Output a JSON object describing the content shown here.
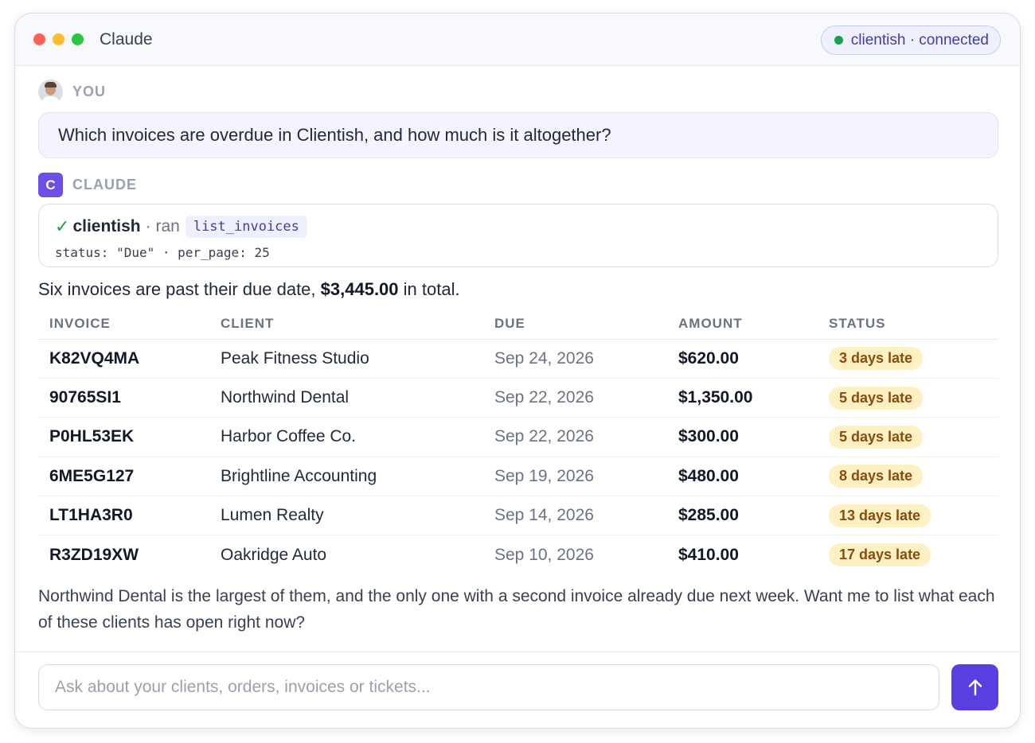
{
  "window": {
    "title": "Claude",
    "connection": "clientish · connected"
  },
  "user_message": {
    "role": "YOU",
    "text": "Which invoices are overdue in Clientish, and how much is it altogether?"
  },
  "assistant": {
    "role": "CLAUDE",
    "avatar_letter": "C",
    "tool_call": {
      "check": "✓",
      "server": "clientish",
      "ran_label": "· ran",
      "function": "list_invoices",
      "args": "status: \"Due\" · per_page: 25"
    },
    "summary_before": "Six invoices are past their due date, ",
    "summary_total": "$3,445.00",
    "summary_after": " in total.",
    "table": {
      "headers": [
        "INVOICE",
        "CLIENT",
        "DUE",
        "AMOUNT",
        "STATUS"
      ],
      "rows": [
        {
          "invoice": "K82VQ4MA",
          "client": "Peak Fitness Studio",
          "due": "Sep 24, 2026",
          "amount": "$620.00",
          "status": "3 days late"
        },
        {
          "invoice": "90765SI1",
          "client": "Northwind Dental",
          "due": "Sep 22, 2026",
          "amount": "$1,350.00",
          "status": "5 days late"
        },
        {
          "invoice": "P0HL53EK",
          "client": "Harbor Coffee Co.",
          "due": "Sep 22, 2026",
          "amount": "$300.00",
          "status": "5 days late"
        },
        {
          "invoice": "6ME5G127",
          "client": "Brightline Accounting",
          "due": "Sep 19, 2026",
          "amount": "$480.00",
          "status": "8 days late"
        },
        {
          "invoice": "LT1HA3R0",
          "client": "Lumen Realty",
          "due": "Sep 14, 2026",
          "amount": "$285.00",
          "status": "13 days late"
        },
        {
          "invoice": "R3ZD19XW",
          "client": "Oakridge Auto",
          "due": "Sep 10, 2026",
          "amount": "$410.00",
          "status": "17 days late"
        }
      ]
    },
    "followup": "Northwind Dental is the largest of them, and the only one with a second invoice already due next week. Want me to list what each of these clients has open right now?"
  },
  "composer": {
    "placeholder": "Ask about your clients, orders, invoices or tickets..."
  },
  "colors": {
    "accent": "#5a3fe0",
    "connected": "#16a34a",
    "late_badge_bg": "#fdf0c3",
    "late_badge_text": "#8a4b0c"
  }
}
